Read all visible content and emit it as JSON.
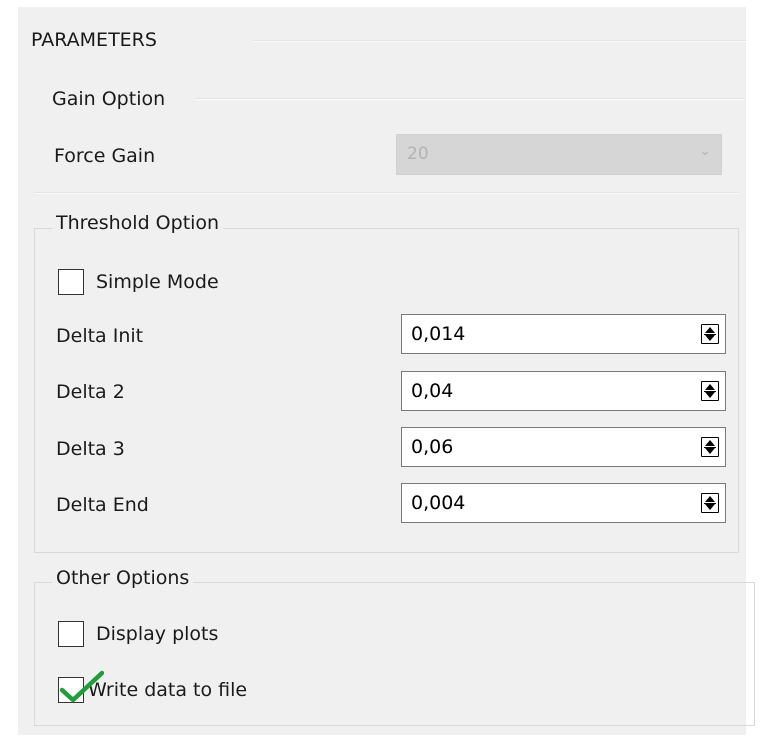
{
  "parameters": {
    "title": "PARAMETERS"
  },
  "gain_option": {
    "title": "Gain Option",
    "force_gain": {
      "label": "Force Gain",
      "value": "20",
      "enabled": false
    }
  },
  "threshold_option": {
    "title": "Threshold Option",
    "simple_mode": {
      "label": "Simple Mode",
      "checked": false
    },
    "fields": [
      {
        "label": "Delta Init",
        "value": "0,014"
      },
      {
        "label": "Delta 2",
        "value": "0,04"
      },
      {
        "label": "Delta 3",
        "value": "0,06"
      },
      {
        "label": "Delta End",
        "value": "0,004"
      }
    ]
  },
  "other_options": {
    "title": "Other Options",
    "display_plots": {
      "label": "Display plots",
      "checked": false
    },
    "write_data": {
      "label": "Write data to file",
      "checked": true
    }
  },
  "colors": {
    "panel_bg": "#f0f0f0",
    "checkmark": "#1f9e3a",
    "disabled_combo": "#d6d6d6"
  },
  "icons": {
    "combo": "chevron-down-icon",
    "spin": "spin-arrows-icon",
    "check": "checkmark-icon"
  }
}
